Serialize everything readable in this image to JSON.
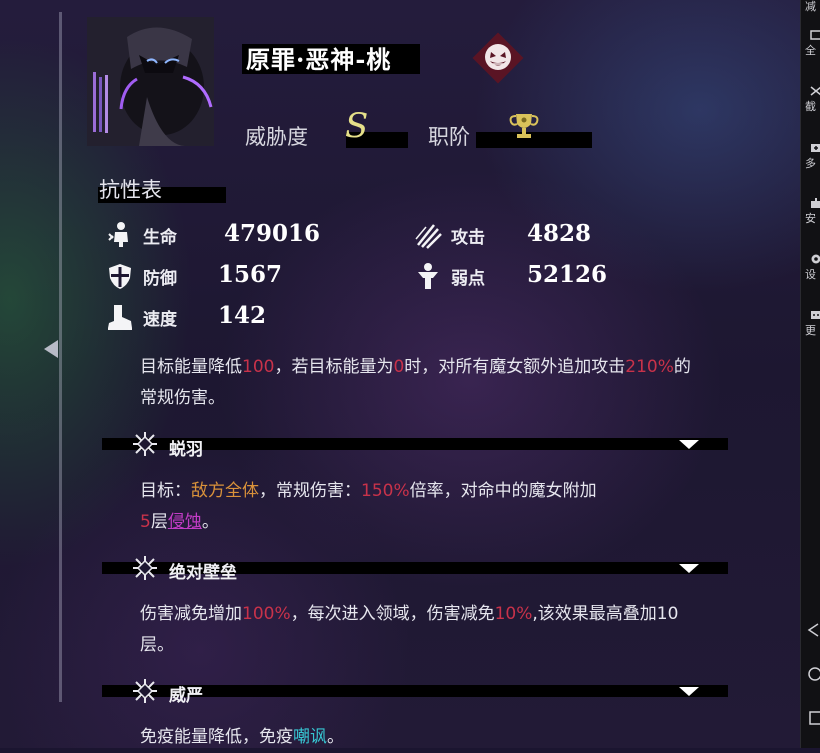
{
  "boss": {
    "name": "原罪·恶神-桃",
    "threat_label": "威胁度",
    "threat_value": "S",
    "rank_label": "职阶"
  },
  "resistance": {
    "title": "抗性表"
  },
  "stats": [
    {
      "icon": "life-icon",
      "label": "生命",
      "value": "479016"
    },
    {
      "icon": "defense-shield-icon",
      "label": "防御",
      "value": "1567"
    },
    {
      "icon": "speed-boot-icon",
      "label": "速度",
      "value": "142"
    },
    {
      "icon": "attack-claw-icon",
      "label": "攻击",
      "value": "4828"
    },
    {
      "icon": "weakness-figure-icon",
      "label": "弱点",
      "value": "52126"
    }
  ],
  "skill_desc": {
    "t1": "目标能量降低",
    "v1": "100",
    "t2": "，若目标能量为",
    "v2": "0",
    "t3": "时，对所有魔女额外追加攻击",
    "v3": "210%",
    "t4": "的常规伤害。"
  },
  "traits": [
    {
      "name": "蜕羽",
      "desc": {
        "t1": "目标：",
        "target": "敌方全体",
        "t2": "，常规伤害：",
        "v1": "150%",
        "t3": "倍率，对命中的魔女附加",
        "v2": "5",
        "t4": "层",
        "link": "侵蚀",
        "t5": "。"
      }
    },
    {
      "name": "绝对壁垒",
      "desc": {
        "t1": "伤害减免增加",
        "v1": "100%",
        "t2": "，每次进入领域，伤害减免",
        "v2": "10%",
        "t3": ",该效果最高叠加10层。"
      }
    },
    {
      "name": "威严",
      "desc": {
        "t1": "免疫能量降低，免疫",
        "link": "嘲讽",
        "t2": "。"
      }
    }
  ],
  "sidebar": {
    "items": [
      {
        "icon": "minimize-icon",
        "label": "减"
      },
      {
        "icon": "fullscreen-icon",
        "label": "全"
      },
      {
        "icon": "scissors-icon",
        "label": "截"
      },
      {
        "icon": "multi-window-icon",
        "label": "多"
      },
      {
        "icon": "install-icon",
        "label": "安"
      },
      {
        "icon": "settings-gear-icon",
        "label": "设"
      },
      {
        "icon": "more-icon",
        "label": "更"
      }
    ]
  },
  "colors": {
    "highlight_red": "#c8324a",
    "highlight_orange": "#d9923a",
    "link_purple": "#c23cc6",
    "link_cyan": "#37c6d2",
    "threat_gold": "#e6e08a"
  }
}
